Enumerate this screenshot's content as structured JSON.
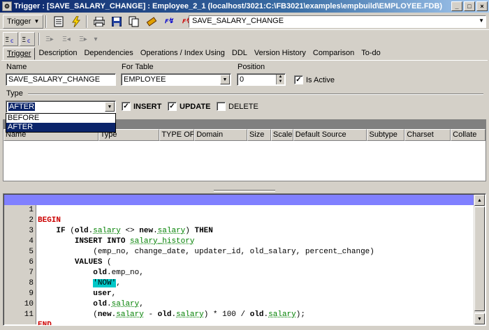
{
  "window": {
    "title": "Trigger : [SAVE_SALARY_CHANGE] : Employee_2_1 (localhost/3021:C:\\FB3021\\examples\\empbuild\\EMPLOYEE.FDB)",
    "minimize": "_",
    "restore": "□",
    "close": "×"
  },
  "toolbar": {
    "trigger_menu": "Trigger",
    "object_name": "SAVE_SALARY_CHANGE"
  },
  "tabs": [
    {
      "label": "Trigger"
    },
    {
      "label": "Description"
    },
    {
      "label": "Dependencies"
    },
    {
      "label": "Operations / Index Using"
    },
    {
      "label": "DDL"
    },
    {
      "label": "Version History"
    },
    {
      "label": "Comparison"
    },
    {
      "label": "To-do"
    }
  ],
  "form": {
    "name_label": "Name",
    "name_value": "SAVE_SALARY_CHANGE",
    "table_label": "For Table",
    "table_value": "EMPLOYEE",
    "position_label": "Position",
    "position_value": "0",
    "is_active_label": "Is Active",
    "is_active": true,
    "type_label": "Type",
    "type_value": "AFTER",
    "type_options": [
      "BEFORE",
      "AFTER"
    ],
    "insert_label": "INSERT",
    "insert_checked": true,
    "update_label": "UPDATE",
    "update_checked": true,
    "delete_label": "DELETE",
    "delete_checked": false
  },
  "grid": {
    "columns": [
      "Name",
      "Type",
      "TYPE OF",
      "Domain",
      "Size",
      "Scale",
      "Default Source",
      "Subtype",
      "Charset",
      "Collate"
    ]
  },
  "editor": {
    "line_numbers": [
      "1",
      "2",
      "3",
      "4",
      "5",
      "6",
      "7",
      "8",
      "9",
      "10",
      "11"
    ],
    "current_line": 1
  }
}
